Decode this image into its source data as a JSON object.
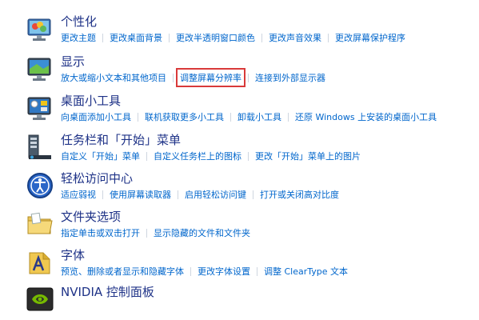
{
  "colors": {
    "title": "#1e3287",
    "link": "#0066cc",
    "highlight": "#d93a3a"
  },
  "categories": [
    {
      "icon": "personalization-icon",
      "title": "个性化",
      "links": [
        "更改主题",
        "更改桌面背景",
        "更改半透明窗口颜色",
        "更改声音效果",
        "更改屏幕保护程序"
      ]
    },
    {
      "icon": "display-icon",
      "title": "显示",
      "links": [
        "放大或缩小文本和其他项目",
        "调整屏幕分辨率",
        "连接到外部显示器"
      ]
    },
    {
      "icon": "desktop-gadgets-icon",
      "title": "桌面小工具",
      "links": [
        "向桌面添加小工具",
        "联机获取更多小工具",
        "卸载小工具",
        "还原 Windows 上安装的桌面小工具"
      ]
    },
    {
      "icon": "taskbar-icon",
      "title": "任务栏和「开始」菜单",
      "links": [
        "自定义「开始」菜单",
        "自定义任务栏上的图标",
        "更改「开始」菜单上的图片"
      ]
    },
    {
      "icon": "ease-of-access-icon",
      "title": "轻松访问中心",
      "links": [
        "适应弱视",
        "使用屏幕读取器",
        "启用轻松访问键",
        "打开或关闭高对比度"
      ]
    },
    {
      "icon": "folder-options-icon",
      "title": "文件夹选项",
      "links": [
        "指定单击或双击打开",
        "显示隐藏的文件和文件夹"
      ]
    },
    {
      "icon": "fonts-icon",
      "title": "字体",
      "links": [
        "预览、删除或者显示和隐藏字体",
        "更改字体设置",
        "调整 ClearType 文本"
      ]
    },
    {
      "icon": "nvidia-icon",
      "title": "NVIDIA 控制面板",
      "links": []
    }
  ]
}
